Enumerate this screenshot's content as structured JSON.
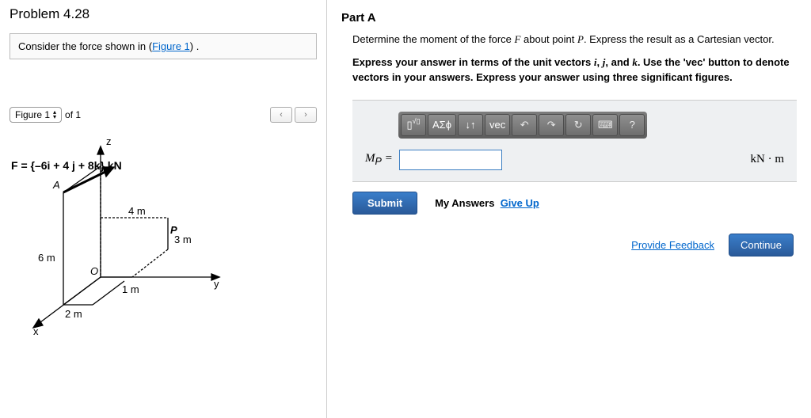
{
  "problem": {
    "title": "Problem 4.28",
    "consider_prefix": "Consider the force shown in (",
    "figure_link": "Figure 1",
    "consider_suffix": ") ."
  },
  "figure": {
    "label_prefix": "Figure 1",
    "of_text": "of 1",
    "nav_prev": "‹",
    "nav_next": "›",
    "force_label": "F = {–6i + 4 j + 8k} kN",
    "dim_4m": "4 m",
    "dim_3m": "3 m",
    "dim_1m": "1 m",
    "dim_6m": "6 m",
    "dim_2m": "2 m",
    "label_A": "A",
    "label_P": "P",
    "label_O": "O",
    "label_x": "x",
    "label_y": "y",
    "label_z": "z"
  },
  "part": {
    "title": "Part A",
    "statement": "Determine the moment of the force F about point P. Express the result as a Cartesian vector.",
    "instructions": "Express your answer in terms of the unit vectors i, j, and k. Use the 'vec' button to denote vectors in your answers. Express your answer using three significant figures."
  },
  "toolbar": {
    "fraction": "▯√▯",
    "greek": "ΑΣϕ",
    "arrows": "↓↑",
    "vec": "vec",
    "undo": "↶",
    "redo": "↷",
    "reset": "↻",
    "keyboard": "⌨",
    "help": "?"
  },
  "answer": {
    "label_html": "M_P =",
    "value": "",
    "unit": "kN · m"
  },
  "actions": {
    "submit": "Submit",
    "my_answers": "My Answers",
    "give_up": "Give Up",
    "provide_feedback": "Provide Feedback",
    "continue": "Continue"
  }
}
